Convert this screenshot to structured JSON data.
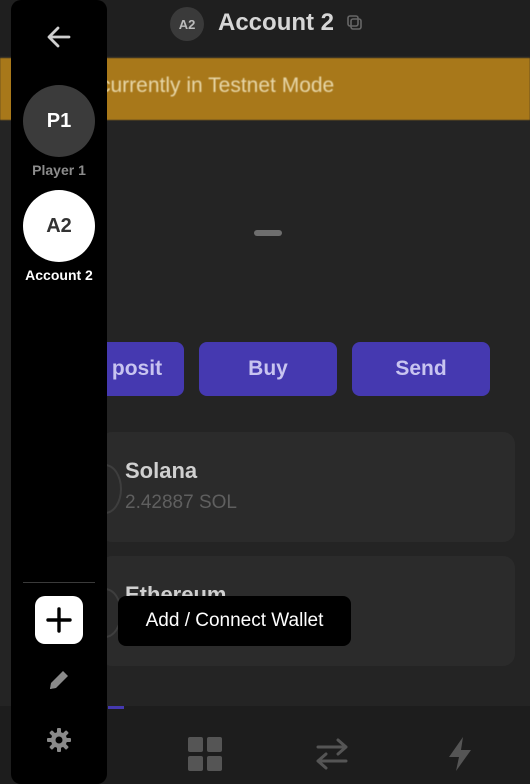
{
  "header": {
    "avatar_initials": "A2",
    "title": "Account 2",
    "copy_icon": "copy-icon"
  },
  "banner": {
    "text": "currently in Testnet Mode",
    "color": "#a8781a"
  },
  "balance": {
    "value": "–"
  },
  "actions": [
    {
      "label": "posit"
    },
    {
      "label": "Buy"
    },
    {
      "label": "Send"
    }
  ],
  "assets": [
    {
      "name": "Solana",
      "amount": "2.42887 SOL"
    },
    {
      "name": "Ethereum",
      "amount": ""
    }
  ],
  "bottom_nav": {
    "icons": [
      "grid-icon",
      "swap-icon",
      "lightning-icon"
    ],
    "accent": "#4539b0"
  },
  "sidebar": {
    "back_icon": "arrow-left-icon",
    "wallets": [
      {
        "initials": "P1",
        "label": "Player 1"
      },
      {
        "initials": "A2",
        "label": "Account 2",
        "selected": true
      }
    ],
    "add_icon": "plus-icon",
    "edit_icon": "pencil-icon",
    "settings_icon": "gear-icon"
  },
  "tooltip": {
    "text": "Add / Connect Wallet"
  }
}
